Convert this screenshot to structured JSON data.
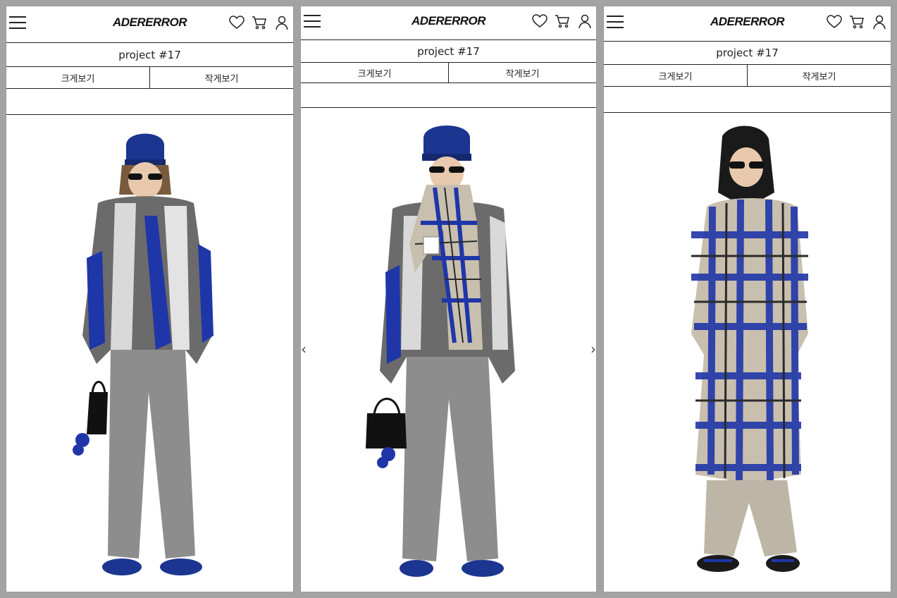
{
  "panels": [
    {
      "header": {
        "logo": "ADERERROR"
      },
      "title": "project #17",
      "view_large": "크게보기",
      "view_small": "작게보기",
      "photo_desc": "model-in-grey-blue-knit-sweater",
      "icons": [
        "menu-icon",
        "heart-icon",
        "cart-icon",
        "user-icon"
      ]
    },
    {
      "header": {
        "logo": "ADERERROR"
      },
      "title": "project #17",
      "view_large": "크게보기",
      "view_small": "작게보기",
      "photo_desc": "model-with-plaid-scarf",
      "icons": [
        "menu-icon",
        "heart-icon",
        "cart-icon",
        "user-icon"
      ],
      "nav": {
        "prev": "‹",
        "next": "›"
      }
    },
    {
      "header": {
        "logo": "ADERERROR"
      },
      "title": "project #17",
      "view_large": "크게보기",
      "view_small": "작게보기",
      "photo_desc": "model-in-plaid-coat",
      "icons": [
        "menu-icon",
        "heart-icon",
        "cart-icon",
        "user-icon"
      ]
    }
  ],
  "colors": {
    "accent_blue": "#1f36a8",
    "beanie_blue": "#1b3590",
    "grey_dark": "#5b5b5b",
    "grey_light": "#d7d7d7",
    "pants_grey": "#8d8d8d",
    "plaid_beige": "#c9bfae",
    "pants_beige": "#bdb6a6"
  }
}
